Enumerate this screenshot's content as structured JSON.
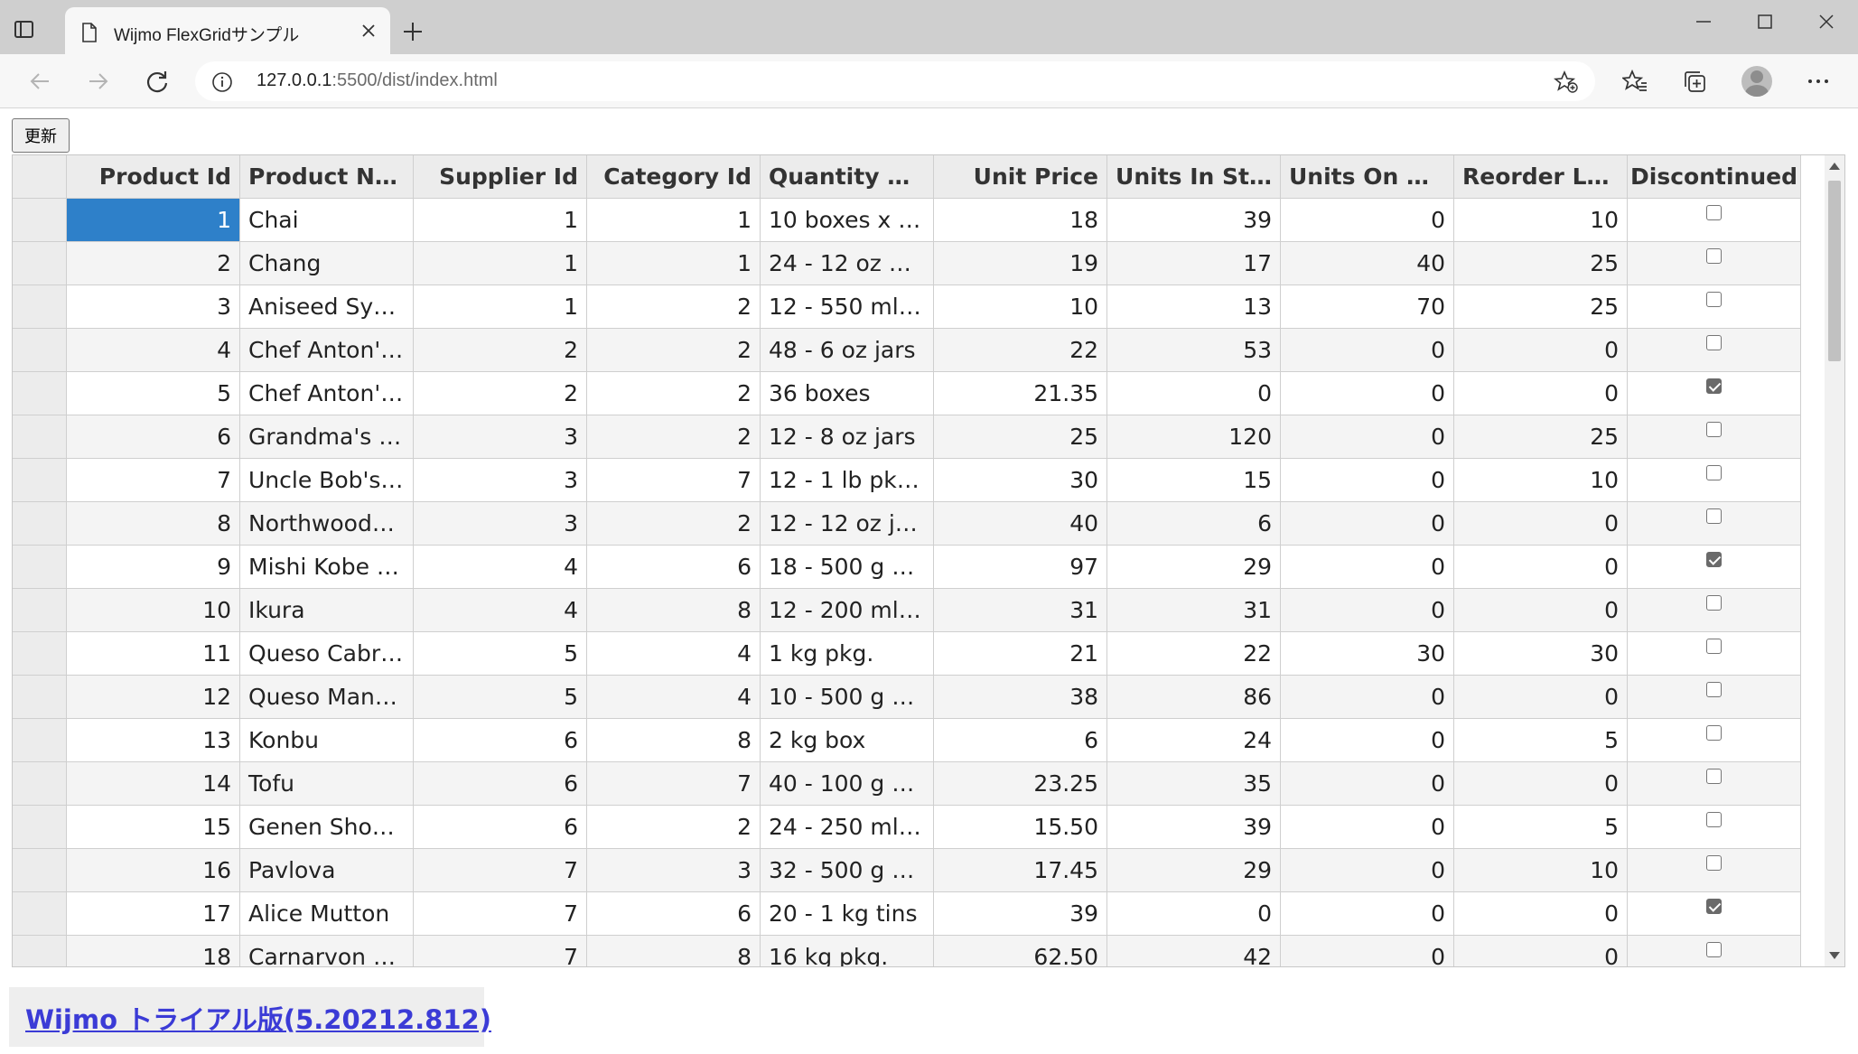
{
  "browser": {
    "tab_title": "Wijmo FlexGridサンプル",
    "url_host": "127.0.0.1",
    "url_rest": ":5500/dist/index.html"
  },
  "icons": {
    "tab_actions": "tab-actions-icon",
    "page": "page-icon",
    "close": "close-icon",
    "new_tab": "plus-icon",
    "back": "back-arrow-icon",
    "forward": "forward-arrow-icon",
    "reload": "reload-icon",
    "info": "info-icon",
    "add_favorite": "star-plus-icon",
    "favorites": "favorites-icon",
    "collections": "collections-icon",
    "profile": "avatar",
    "menu": "more-icon"
  },
  "page": {
    "refresh_label": "更新",
    "trial_link": "Wijmo トライアル版(5.20212.812)"
  },
  "colors": {
    "selection": "#2e80c9",
    "header_bg": "#ececec",
    "link": "#3b3bd6"
  },
  "grid": {
    "columns": [
      {
        "label": "Product Id",
        "type": "num"
      },
      {
        "label": "Product Na…",
        "type": "text"
      },
      {
        "label": "Supplier Id",
        "type": "num"
      },
      {
        "label": "Category Id",
        "type": "num"
      },
      {
        "label": "Quantity Pe…",
        "type": "text"
      },
      {
        "label": "Unit Price",
        "type": "num"
      },
      {
        "label": "Units In St…",
        "type": "num"
      },
      {
        "label": "Units On Or…",
        "type": "num"
      },
      {
        "label": "Reorder Le…",
        "type": "num"
      },
      {
        "label": "Discontinued",
        "type": "bool"
      }
    ],
    "selected_cell": {
      "row": 0,
      "col": 0
    },
    "rows": [
      [
        "1",
        "Chai",
        "1",
        "1",
        "10 boxes x …",
        "18",
        "39",
        "0",
        "10",
        false
      ],
      [
        "2",
        "Chang",
        "1",
        "1",
        "24 - 12 oz b…",
        "19",
        "17",
        "40",
        "25",
        false
      ],
      [
        "3",
        "Aniseed Syrup",
        "1",
        "2",
        "12 - 550 ml …",
        "10",
        "13",
        "70",
        "25",
        false
      ],
      [
        "4",
        "Chef Anton's…",
        "2",
        "2",
        "48 - 6 oz jars",
        "22",
        "53",
        "0",
        "0",
        false
      ],
      [
        "5",
        "Chef Anton's…",
        "2",
        "2",
        "36 boxes",
        "21.35",
        "0",
        "0",
        "0",
        true
      ],
      [
        "6",
        "Grandma's …",
        "3",
        "2",
        "12 - 8 oz jars",
        "25",
        "120",
        "0",
        "25",
        false
      ],
      [
        "7",
        "Uncle Bob's …",
        "3",
        "7",
        "12 - 1 lb pkgs.",
        "30",
        "15",
        "0",
        "10",
        false
      ],
      [
        "8",
        "Northwoods…",
        "3",
        "2",
        "12 - 12 oz j…",
        "40",
        "6",
        "0",
        "0",
        false
      ],
      [
        "9",
        "Mishi Kobe …",
        "4",
        "6",
        "18 - 500 g p…",
        "97",
        "29",
        "0",
        "0",
        true
      ],
      [
        "10",
        "Ikura",
        "4",
        "8",
        "12 - 200 ml …",
        "31",
        "31",
        "0",
        "0",
        false
      ],
      [
        "11",
        "Queso Cabr…",
        "5",
        "4",
        "1 kg pkg.",
        "21",
        "22",
        "30",
        "30",
        false
      ],
      [
        "12",
        "Queso Manc…",
        "5",
        "4",
        "10 - 500 g p…",
        "38",
        "86",
        "0",
        "0",
        false
      ],
      [
        "13",
        "Konbu",
        "6",
        "8",
        "2 kg box",
        "6",
        "24",
        "0",
        "5",
        false
      ],
      [
        "14",
        "Tofu",
        "6",
        "7",
        "40 - 100 g p…",
        "23.25",
        "35",
        "0",
        "0",
        false
      ],
      [
        "15",
        "Genen Shouyu",
        "6",
        "2",
        "24 - 250 ml …",
        "15.50",
        "39",
        "0",
        "5",
        false
      ],
      [
        "16",
        "Pavlova",
        "7",
        "3",
        "32 - 500 g b…",
        "17.45",
        "29",
        "0",
        "10",
        false
      ],
      [
        "17",
        "Alice Mutton",
        "7",
        "6",
        "20 - 1 kg tins",
        "39",
        "0",
        "0",
        "0",
        true
      ],
      [
        "18",
        "Carnarvon T…",
        "7",
        "8",
        "16 kg pkg.",
        "62.50",
        "42",
        "0",
        "0",
        false
      ]
    ]
  }
}
